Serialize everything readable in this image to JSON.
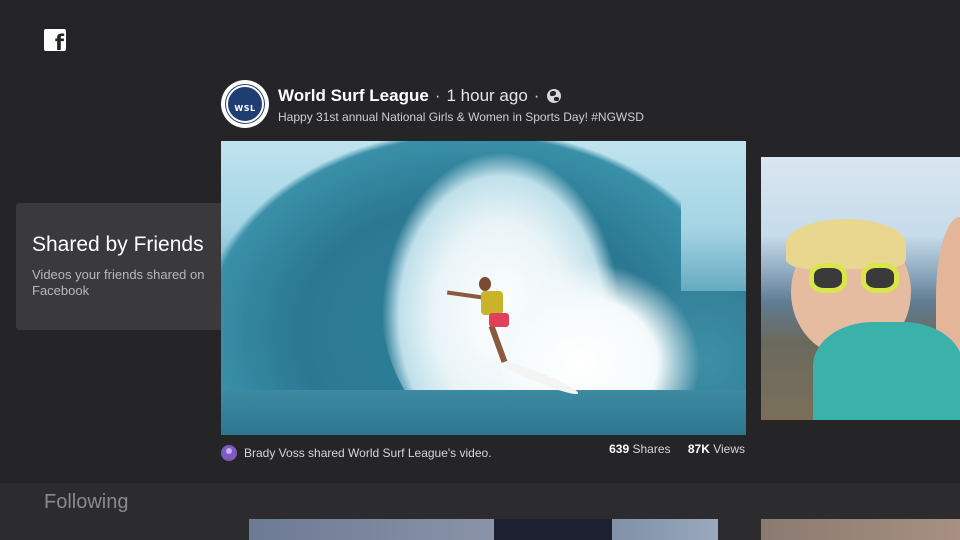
{
  "brand": {
    "logo_glyph": "f",
    "icon": "facebook-logo-icon"
  },
  "section": {
    "title": "Shared by Friends",
    "description": "Videos your friends shared on Facebook"
  },
  "post": {
    "page_name": "World Surf League",
    "separator": "·",
    "time": "1 hour ago",
    "privacy_icon": "globe-icon",
    "caption": "Happy 31st annual National Girls & Women in Sports Day! #NGWSD",
    "avatar_text": "WSL"
  },
  "share": {
    "text": "Brady Voss shared World Surf League's video.",
    "shares_count": "639",
    "shares_label": "Shares",
    "views_count": "87K",
    "views_label": "Views"
  },
  "following": {
    "label": "Following"
  },
  "colors": {
    "background": "#252527",
    "card": "#3a3a3d",
    "text_secondary": "#b8b8bc"
  }
}
